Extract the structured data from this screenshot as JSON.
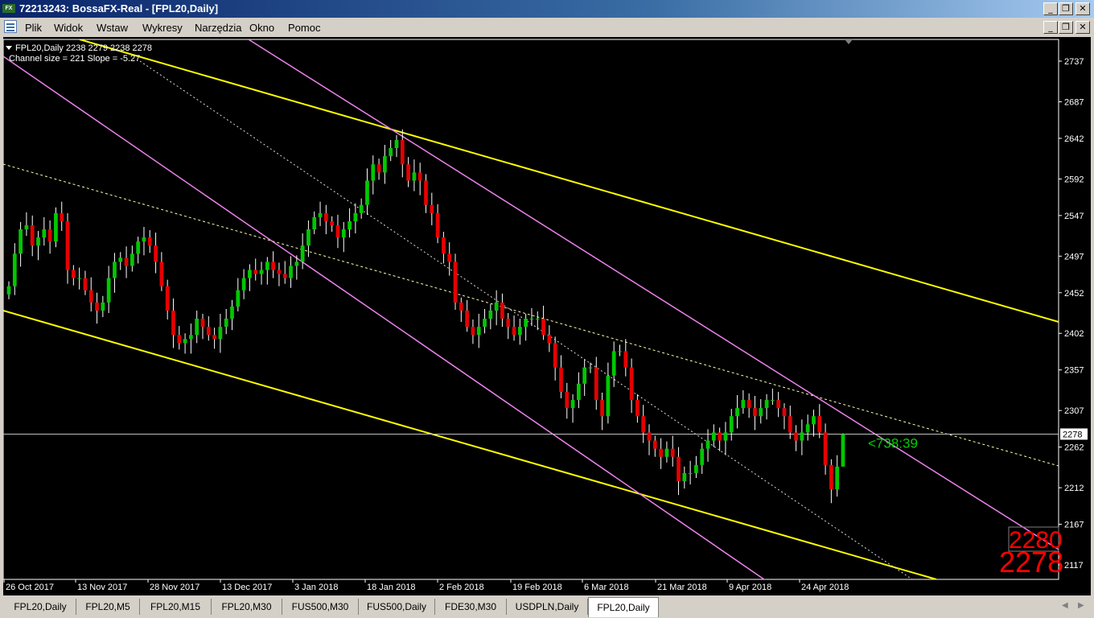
{
  "window": {
    "title": "72213243: BossaFX-Real - [FPL20,Daily]",
    "app_icon_text": "FX"
  },
  "menu": [
    "Plik",
    "Widok",
    "Wstaw",
    "Wykresy",
    "Narzędzia",
    "Okno",
    "Pomoc"
  ],
  "chart": {
    "symbol_info": "FPL20,Daily  2238 2279 2238 2278",
    "channel_info": "Channel size = 221 Slope = -5.27",
    "timer": "<738:39",
    "current_price_label": "2278",
    "bid_big": "2280",
    "ask_big": "2278",
    "colors": {
      "background": "#000000",
      "bull": "#00c800",
      "bear": "#e60000",
      "channel_yellow": "#ffff00",
      "channel_violet": "#ee82ee",
      "price_line": "#c0c0c0",
      "timer": "#00d000",
      "big_price": "#ff0000"
    }
  },
  "chart_data": {
    "type": "candlestick",
    "y_ticks": [
      2737,
      2687,
      2642,
      2592,
      2547,
      2497,
      2452,
      2402,
      2357,
      2307,
      2262,
      2212,
      2167,
      2117
    ],
    "x_labels": [
      "26 Oct 2017",
      "13 Nov 2017",
      "28 Nov 2017",
      "13 Dec 2017",
      "3 Jan 2018",
      "18 Jan 2018",
      "2 Feb 2018",
      "19 Feb 2018",
      "6 Mar 2018",
      "21 Mar 2018",
      "9 Apr 2018",
      "24 Apr 2018"
    ],
    "ylim": [
      2103,
      2763
    ],
    "last_bar": {
      "open": 2238,
      "high": 2279,
      "low": 2238,
      "close": 2278
    },
    "closes": [
      2460,
      2500,
      2530,
      2535,
      2510,
      2520,
      2530,
      2515,
      2550,
      2540,
      2480,
      2470,
      2470,
      2455,
      2440,
      2430,
      2440,
      2470,
      2490,
      2495,
      2485,
      2500,
      2515,
      2520,
      2510,
      2490,
      2460,
      2430,
      2400,
      2390,
      2395,
      2400,
      2420,
      2410,
      2400,
      2395,
      2410,
      2420,
      2435,
      2455,
      2470,
      2480,
      2475,
      2480,
      2490,
      2480,
      2475,
      2470,
      2485,
      2490,
      2510,
      2530,
      2545,
      2550,
      2540,
      2535,
      2520,
      2530,
      2540,
      2550,
      2560,
      2590,
      2610,
      2600,
      2620,
      2630,
      2640,
      2610,
      2590,
      2600,
      2590,
      2560,
      2550,
      2520,
      2500,
      2490,
      2440,
      2430,
      2410,
      2400,
      2410,
      2420,
      2430,
      2440,
      2420,
      2410,
      2400,
      2410,
      2420,
      2420,
      2420,
      2400,
      2390,
      2360,
      2330,
      2310,
      2320,
      2340,
      2360,
      2360,
      2320,
      2300,
      2350,
      2380,
      2380,
      2360,
      2320,
      2300,
      2280,
      2270,
      2260,
      2250,
      2260,
      2250,
      2220,
      2230,
      2230,
      2240,
      2260,
      2270,
      2280,
      2270,
      2280,
      2300,
      2310,
      2320,
      2310,
      2300,
      2310,
      2320,
      2320,
      2310,
      2300,
      2280,
      2270,
      2280,
      2290,
      2300,
      2280,
      2240,
      2210,
      2238,
      2278
    ]
  },
  "tabs": [
    "FPL20,Daily",
    "FPL20,M5",
    "FPL20,M15",
    "FPL20,M30",
    "FUS500,M30",
    "FUS500,Daily",
    "FDE30,M30",
    "USDPLN,Daily",
    "FPL20,Daily"
  ],
  "active_tab": 8
}
